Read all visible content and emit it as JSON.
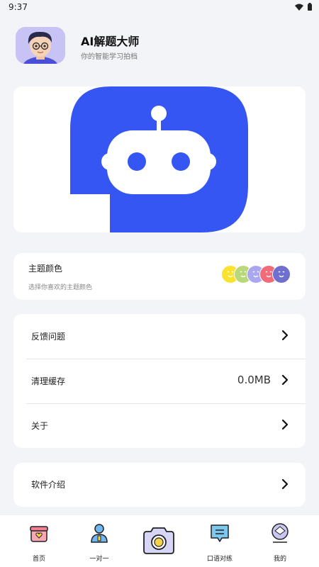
{
  "status": {
    "time": "9:37"
  },
  "profile": {
    "title": "AI解题大师",
    "subtitle": "你的智能学习拍档"
  },
  "theme": {
    "title": "主题颜色",
    "subtitle": "选择你喜欢的主题颜色",
    "swatches": [
      "#f9e230",
      "#b9d87a",
      "#a9a7f0",
      "#f36b78",
      "#6f6fd0"
    ]
  },
  "menu": {
    "feedback": "反馈问题",
    "clear_cache": "清理缓存",
    "cache_size": "0.0MB",
    "about": "关于",
    "intro": "软件介绍"
  },
  "tabs": {
    "home": "首页",
    "one_on_one": "一对一",
    "speaking": "口语对练",
    "mine": "我的"
  },
  "colors": {
    "brand_blue": "#3556f2",
    "background": "#f3f4f8"
  }
}
